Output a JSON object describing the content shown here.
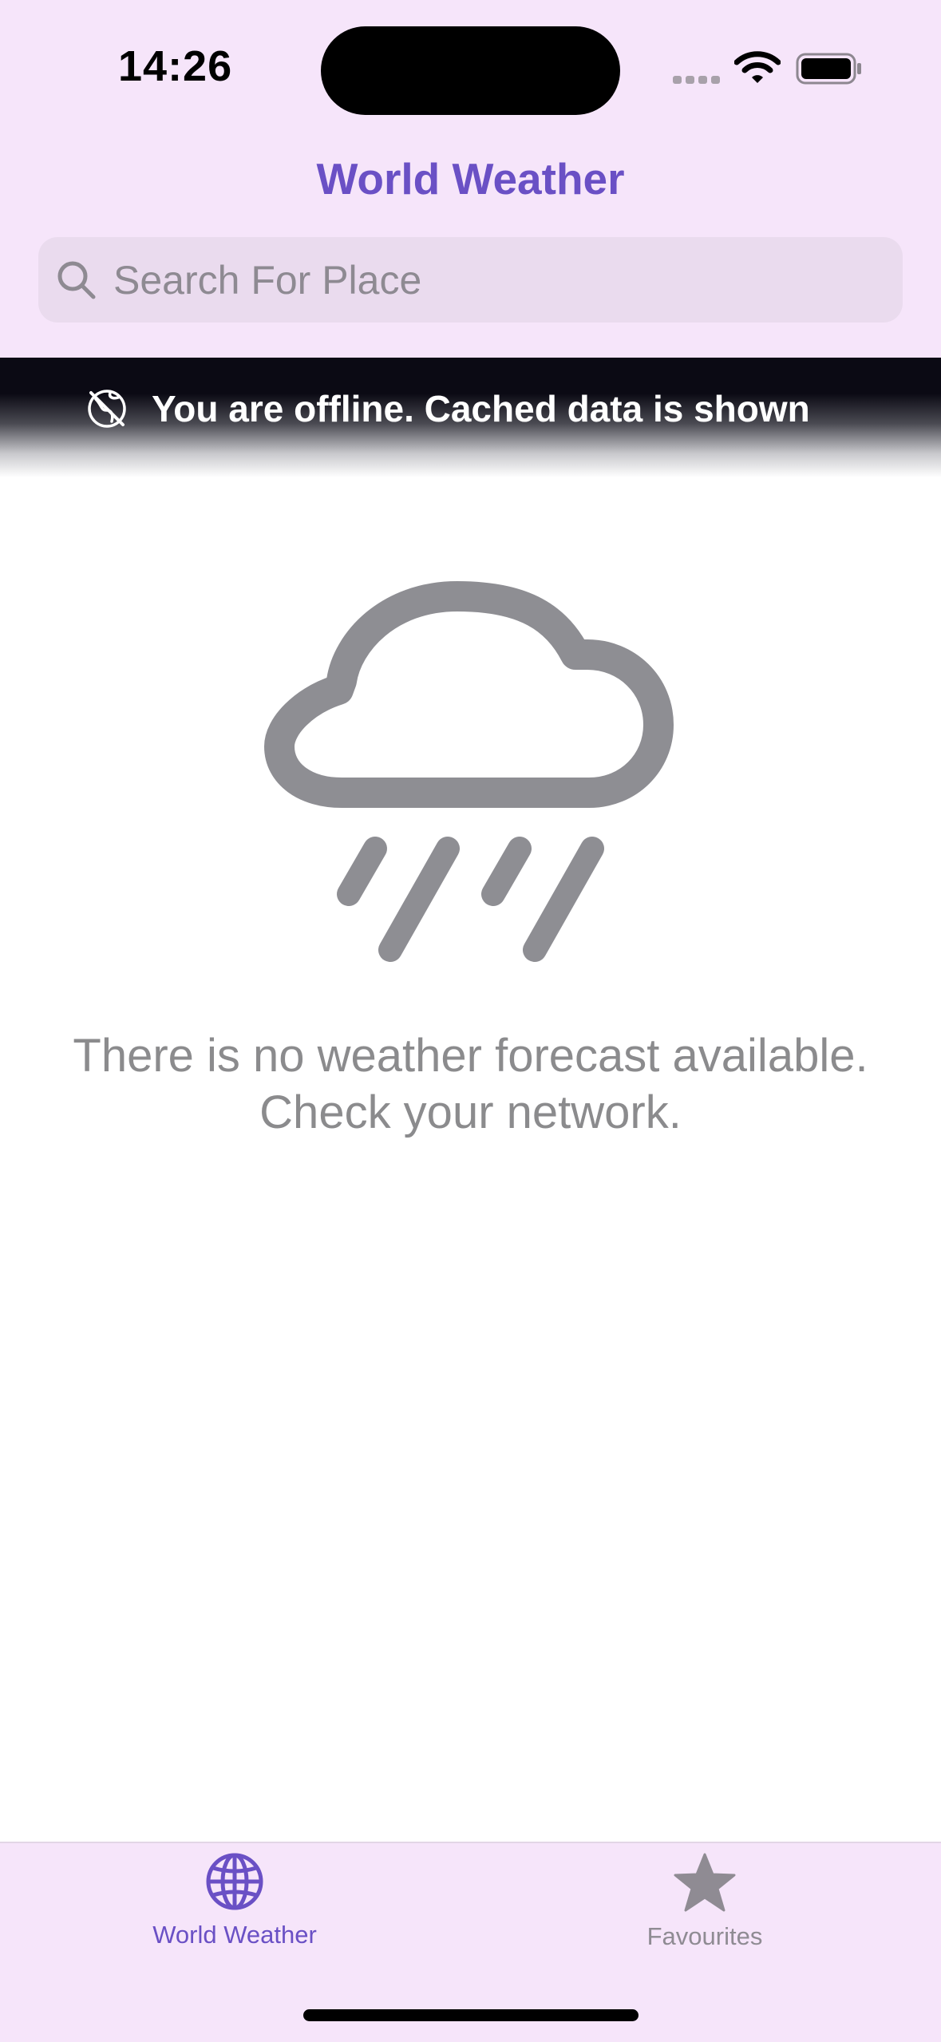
{
  "status_bar": {
    "time": "14:26"
  },
  "header": {
    "title": "World Weather"
  },
  "search": {
    "placeholder": "Search For Place",
    "value": ""
  },
  "offline_banner": {
    "message": "You are offline. Cached data is shown",
    "icon": "offline-globe-icon"
  },
  "empty_state": {
    "icon": "cloud-rain-icon",
    "message": "There is no weather forecast available.\nCheck your network."
  },
  "tab_bar": {
    "tabs": [
      {
        "label": "World Weather",
        "icon": "globe-icon",
        "selected": true
      },
      {
        "label": "Favourites",
        "icon": "star-icon",
        "selected": false
      }
    ]
  },
  "colors": {
    "accent": "#6a50c5",
    "header_background": "#f6e5fa",
    "search_background": "#eadbee",
    "banner_background": "#0b0a14",
    "muted_text": "#8b8b8d",
    "inactive_tab": "#8f8b93"
  }
}
